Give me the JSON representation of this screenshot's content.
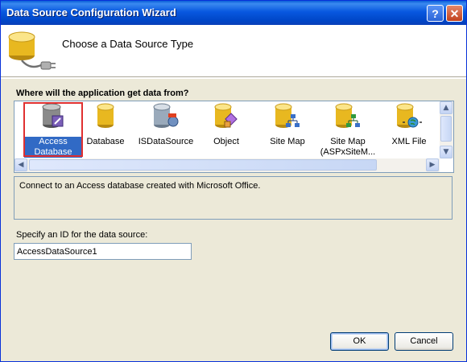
{
  "window": {
    "title": "Data Source Configuration Wizard",
    "help_glyph": "?",
    "close_glyph": "✕"
  },
  "header": {
    "title": "Choose a Data Source Type",
    "icon": "database-plug-icon"
  },
  "prompt": "Where will the application get data from?",
  "data_sources": [
    {
      "label_line1": "Access",
      "label_line2": "Database",
      "icon": "access-database-icon",
      "selected": true
    },
    {
      "label_line1": "Database",
      "label_line2": "",
      "icon": "database-icon",
      "selected": false
    },
    {
      "label_line1": "ISDataSource",
      "label_line2": "",
      "icon": "isdatasource-icon",
      "selected": false
    },
    {
      "label_line1": "Object",
      "label_line2": "",
      "icon": "object-icon",
      "selected": false
    },
    {
      "label_line1": "Site Map",
      "label_line2": "",
      "icon": "site-map-icon",
      "selected": false
    },
    {
      "label_line1": "Site Map",
      "label_line2": "(ASPxSiteM...",
      "icon": "aspx-site-map-icon",
      "selected": false
    },
    {
      "label_line1": "XML File",
      "label_line2": "",
      "icon": "xml-file-icon",
      "selected": false
    }
  ],
  "description": "Connect to an Access database created with Microsoft Office.",
  "id_field": {
    "label": "Specify an ID for the data source:",
    "value": "AccessDataSource1"
  },
  "buttons": {
    "ok": "OK",
    "cancel": "Cancel"
  },
  "colors": {
    "title_bar": "#0858e0",
    "selection": "#316ac5",
    "selection_outline": "#e03030",
    "dialog_bg": "#ece9d8"
  }
}
